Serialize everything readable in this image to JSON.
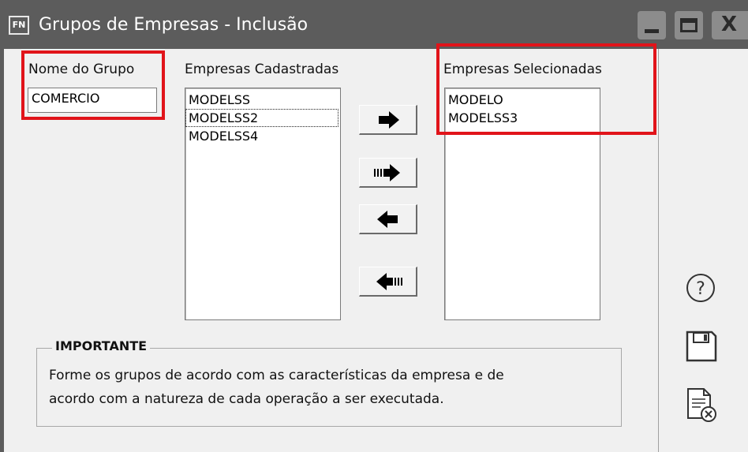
{
  "window": {
    "app_icon_text": "FN",
    "title": "Grupos de Empresas - Inclusão",
    "controls": {
      "minimize_icon": "minimize-icon",
      "maximize_icon": "maximize-icon",
      "close_icon": "close-icon",
      "close_glyph": "X"
    }
  },
  "group_name": {
    "label": "Nome do Grupo",
    "value": "COMERCIO"
  },
  "available_companies": {
    "label": "Empresas Cadastradas",
    "items": [
      "MODELSS",
      "MODELSS2",
      "MODELSS4"
    ],
    "focused_item": "MODELSS2"
  },
  "selected_companies": {
    "label": "Empresas Selecionadas",
    "items": [
      "MODELO",
      "MODELSS3"
    ]
  },
  "transfer_buttons": [
    {
      "name": "add-one-button",
      "icon": "arrow-right-icon"
    },
    {
      "name": "add-all-button",
      "icon": "arrow-right-all-icon"
    },
    {
      "name": "remove-one-button",
      "icon": "arrow-left-icon"
    },
    {
      "name": "remove-all-button",
      "icon": "arrow-left-all-icon"
    }
  ],
  "important": {
    "title": "IMPORTANTE",
    "line1": "Forme os grupos de acordo com as características da empresa e de",
    "line2": "acordo com a natureza de cada operação a ser executada."
  },
  "side_buttons": [
    {
      "name": "help-button",
      "icon": "help-icon",
      "glyph": "?"
    },
    {
      "name": "save-button",
      "icon": "save-icon"
    },
    {
      "name": "cancel-button",
      "icon": "cancel-document-icon"
    }
  ],
  "colors": {
    "titlebar": "#5c5c5c",
    "highlight_border": "#e1141a",
    "window_background": "#f0f0f0"
  }
}
